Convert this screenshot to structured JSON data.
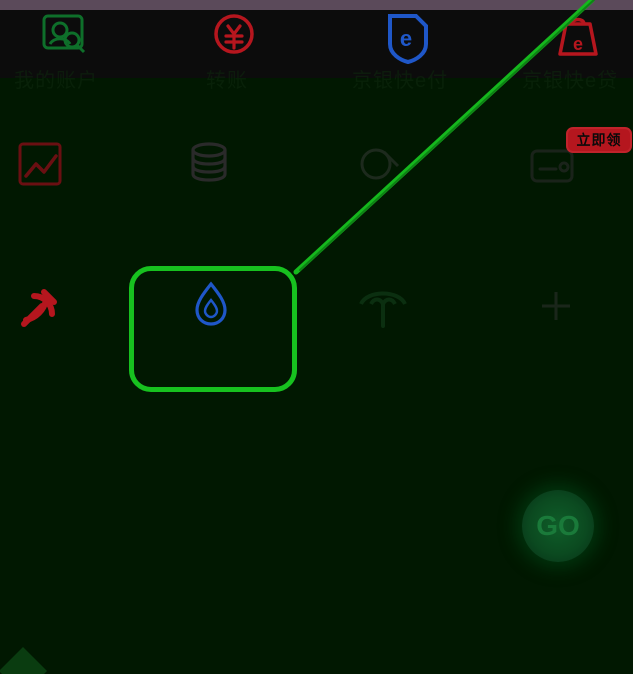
{
  "top_nav": {
    "items": [
      {
        "label": "我的账户",
        "icon": "account-search-icon"
      },
      {
        "label": "转账",
        "icon": "transfer-yuan-icon"
      },
      {
        "label": "京银快e付",
        "icon": "e-pay-shield-icon"
      },
      {
        "label": "京银快e贷",
        "icon": "e-loan-bag-icon"
      }
    ]
  },
  "grid": {
    "badge": "立即领",
    "row2": [
      {
        "icon": "trend-chart-icon"
      },
      {
        "icon": "coins-stack-icon"
      },
      {
        "icon": "fund-icon"
      },
      {
        "icon": "wallet-icon"
      }
    ],
    "row3": [
      {
        "icon": "party-emblem-icon"
      },
      {
        "icon": "water-drop-icon"
      },
      {
        "icon": "umbrella-icon"
      },
      {
        "icon": "plus-icon"
      }
    ]
  },
  "floating_action": {
    "label": "GO",
    "icon": "go-button"
  },
  "colors": {
    "background": "#011801",
    "highlight": "#17c11f",
    "accent_red": "#b5161e",
    "accent_blue": "#1f57c8"
  }
}
